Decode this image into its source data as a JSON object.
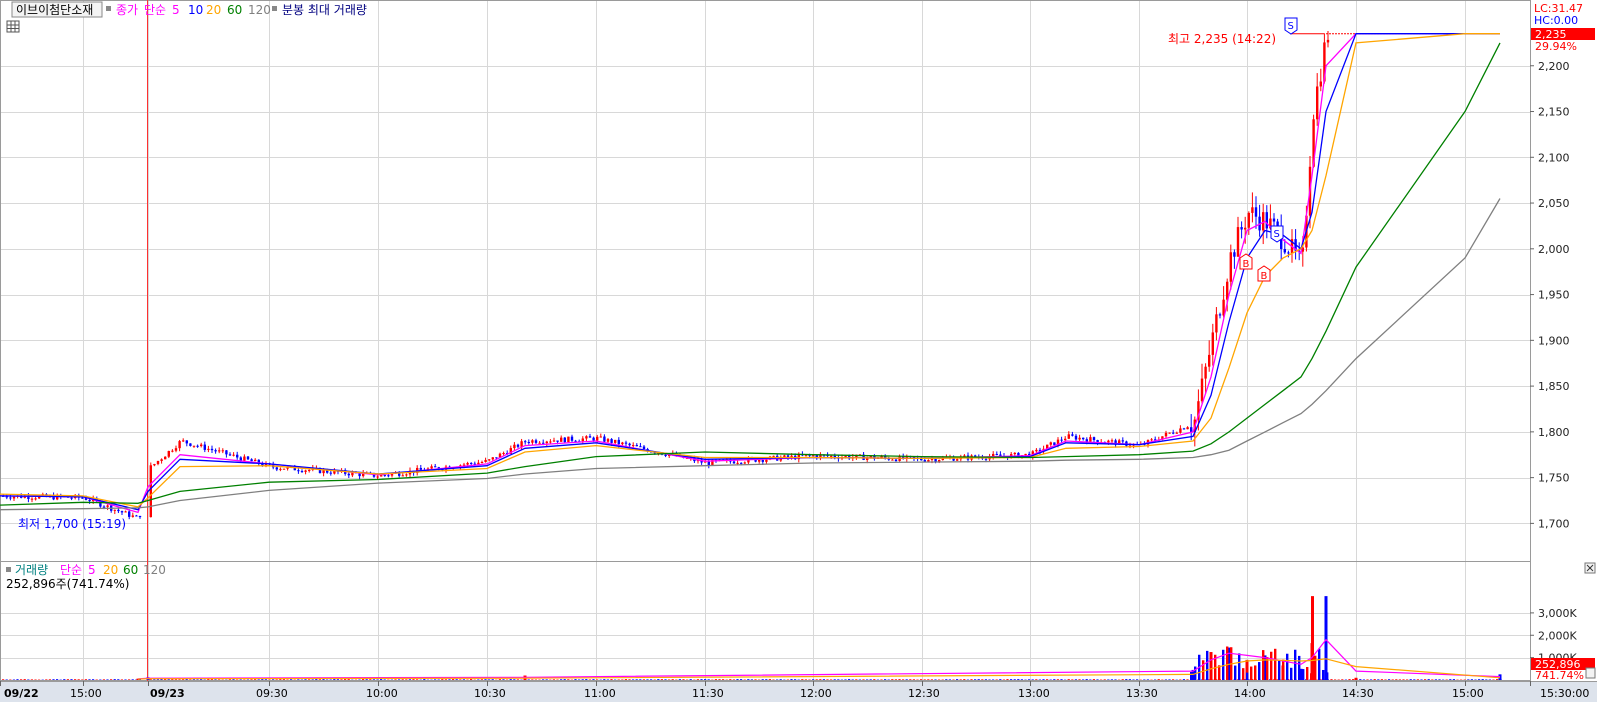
{
  "colors": {
    "up": "#ff0000",
    "down": "#0000ff",
    "ma5": "#ff00ff",
    "ma10": "#0000ff",
    "ma20": "#ffa500",
    "ma60": "#008000",
    "ma120": "#808080",
    "grid": "#d8d8d8",
    "axis_bg": "#ffffff"
  },
  "price_panel": {
    "legend": {
      "stock_name": "이브이첨단소재",
      "close_label": "종가",
      "ma_label": "단순",
      "periods": [
        "5",
        "10",
        "20",
        "60",
        "120"
      ],
      "extra": "분봉 최대 거래량"
    },
    "lc_label": "LC:31.47",
    "hc_label": "HC:0.00",
    "current_price": "2,235",
    "current_pct": "29.94%",
    "high_note": "최고 2,235 (14:22)",
    "low_note": "최저 1,700 (15:19)",
    "signals": [
      "S",
      "S",
      "B",
      "B"
    ]
  },
  "volume_panel": {
    "legend": {
      "label": "거래량",
      "ma_label": "단순",
      "periods": [
        "5",
        "20",
        "60",
        "120"
      ]
    },
    "value_line": "252,896주(741.74%)",
    "current_volume": "252,896",
    "current_pct": "741.74%"
  },
  "x_axis": {
    "labels": [
      "09/22",
      "15:00",
      "09/23",
      "09:30",
      "10:00",
      "10:30",
      "11:00",
      "11:30",
      "12:00",
      "12:30",
      "13:00",
      "13:30",
      "14:00",
      "14:30",
      "15:00",
      "15:30:00"
    ]
  },
  "chart_data": [
    {
      "type": "candlestick",
      "title": "이브이첨단소재",
      "y_ticks": [
        2200,
        2150,
        2100,
        2050,
        2000,
        1950,
        1900,
        1850,
        1800,
        1750,
        1700
      ],
      "y_tick_labels": [
        "2,200",
        "2,150",
        "2,100",
        "2,050",
        "2,000",
        "1,950",
        "1,900",
        "1,850",
        "1,800",
        "1,750",
        "1,700"
      ],
      "ylim": [
        1660,
        2250
      ],
      "x": [
        "09/22 14:40",
        "09/22 15:00",
        "09/22 15:19",
        "09/23 09:00",
        "09/23 09:10",
        "09/23 09:30",
        "09/23 10:00",
        "09/23 10:30",
        "09/23 10:40",
        "09/23 11:00",
        "09/23 11:30",
        "09/23 12:00",
        "09/23 12:30",
        "09/23 13:00",
        "09/23 13:10",
        "09/23 13:30",
        "09/23 13:45",
        "09/23 13:50",
        "09/23 13:55",
        "09/23 14:00",
        "09/23 14:05",
        "09/23 14:10",
        "09/23 14:15",
        "09/23 14:18",
        "09/23 14:22",
        "09/23 14:30",
        "09/23 15:00",
        "09/23 15:20"
      ],
      "series": [
        {
          "name": "종가",
          "values": [
            1730,
            1728,
            1705,
            1760,
            1790,
            1762,
            1752,
            1768,
            1790,
            1793,
            1766,
            1774,
            1770,
            1775,
            1795,
            1785,
            1810,
            1900,
            1990,
            2040,
            2030,
            2010,
            1980,
            2150,
            2235,
            2235,
            2235,
            2235
          ]
        },
        {
          "name": "5",
          "values": [
            1730,
            1729,
            1712,
            1740,
            1775,
            1765,
            1753,
            1765,
            1785,
            1790,
            1768,
            1772,
            1771,
            1774,
            1790,
            1786,
            1800,
            1860,
            1950,
            2020,
            2030,
            2010,
            1995,
            2080,
            2200,
            2235,
            2235,
            2235
          ]
        },
        {
          "name": "10",
          "values": [
            1730,
            1729,
            1715,
            1735,
            1770,
            1765,
            1754,
            1763,
            1782,
            1788,
            1770,
            1772,
            1771,
            1773,
            1788,
            1786,
            1795,
            1840,
            1920,
            1990,
            2020,
            2015,
            2000,
            2040,
            2150,
            2235,
            2235,
            2235
          ]
        },
        {
          "name": "20",
          "values": [
            1732,
            1730,
            1718,
            1728,
            1762,
            1763,
            1754,
            1760,
            1778,
            1785,
            1772,
            1772,
            1771,
            1772,
            1782,
            1784,
            1790,
            1815,
            1870,
            1930,
            1970,
            1990,
            2000,
            2020,
            2080,
            2225,
            2235,
            2235
          ]
        },
        {
          "name": "60",
          "values": [
            1720,
            1723,
            1722,
            1725,
            1735,
            1745,
            1748,
            1755,
            1762,
            1773,
            1778,
            1775,
            1773,
            1772,
            1773,
            1775,
            1779,
            1787,
            1800,
            1815,
            1830,
            1845,
            1860,
            1880,
            1910,
            1980,
            2150,
            2225
          ]
        },
        {
          "name": "120",
          "values": [
            1715,
            1716,
            1717,
            1718,
            1725,
            1736,
            1744,
            1749,
            1754,
            1760,
            1763,
            1766,
            1767,
            1768,
            1769,
            1770,
            1772,
            1775,
            1780,
            1790,
            1800,
            1810,
            1820,
            1830,
            1845,
            1880,
            1990,
            2055
          ]
        }
      ],
      "annotations": [
        "최고 2,235 (14:22)",
        "최저 1,700 (15:19)"
      ]
    },
    {
      "type": "bar",
      "title": "거래량",
      "y_ticks": [
        3000,
        2000,
        1000
      ],
      "y_tick_labels": [
        "3,000K",
        "2,000K",
        "1,000K"
      ],
      "ylim": [
        0,
        3800
      ],
      "unit": "K",
      "x": [
        "09/22 15:19",
        "09/23 09:00",
        "09/23 10:40",
        "09/23 13:45",
        "09/23 13:50",
        "09/23 13:55",
        "09/23 14:00",
        "09/23 14:05",
        "09/23 14:10",
        "09/23 14:15",
        "09/23 14:18",
        "09/23 14:22",
        "09/23 14:30",
        "09/23 15:20"
      ],
      "values": [
        60,
        120,
        200,
        450,
        1250,
        1450,
        900,
        1100,
        650,
        500,
        1650,
        3750,
        100,
        253
      ],
      "series": [
        {
          "name": "5",
          "values": [
            50,
            80,
            120,
            400,
            900,
            1200,
            1100,
            1000,
            850,
            700,
            1000,
            1800,
            400,
            150
          ]
        },
        {
          "name": "20",
          "values": [
            40,
            60,
            80,
            250,
            500,
            700,
            850,
            900,
            880,
            850,
            870,
            950,
            600,
            100
          ]
        }
      ]
    }
  ]
}
